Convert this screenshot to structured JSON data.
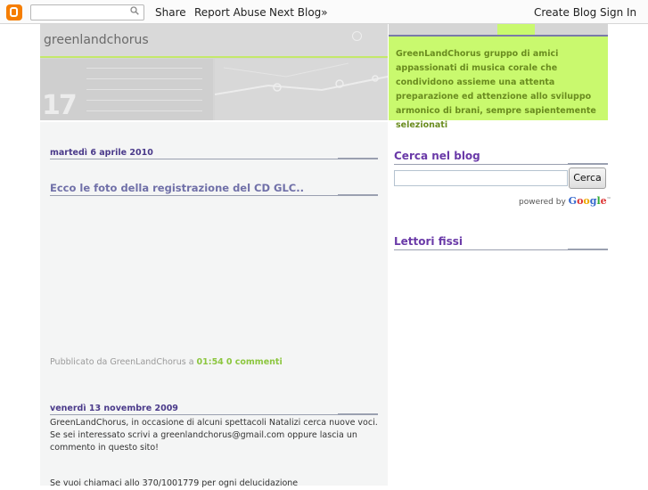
{
  "navbar": {
    "search_placeholder": "",
    "links": [
      "Share",
      "Report Abuse",
      "Next Blog»"
    ],
    "right_links": [
      "Create Blog",
      "Sign In"
    ]
  },
  "header": {
    "title": "greenlandchorus",
    "number": "17",
    "description": "GreenLandChorus gruppo di amici appassionati di musica corale che condividono assieme una attenta preparazione ed attenzione allo sviluppo armonico di brani, sempre sapientemente selezionati"
  },
  "posts": [
    {
      "date": "martedì 6 aprile 2010",
      "title": "Ecco le foto della registrazione del CD GLC..",
      "footer_prefix": "Pubblicato da GreenLandChorus a ",
      "time": "01:54",
      "comments": "0 commenti"
    },
    {
      "date": "venerdì 13 novembre 2009",
      "body": [
        "GreenLandChorus, in occasione di alcuni spettacoli Natalizi cerca nuove voci.",
        "Se sei interessato scrivi a greenlandchorus@gmail.com oppure lascia un",
        "commento in questo sito!",
        "",
        "Se vuoi chiamaci allo 370/1001779 per ogni delucidazione"
      ]
    }
  ],
  "sidebar": {
    "search_title": "Cerca nel blog",
    "search_button": "Cerca",
    "powered_by": "powered by",
    "google": "Google",
    "followers_title": "Lettori fissi"
  },
  "colors": {
    "accent_green": "#c9f96e",
    "title_purple": "#6a3aa8",
    "link_green": "#8cc63f"
  }
}
